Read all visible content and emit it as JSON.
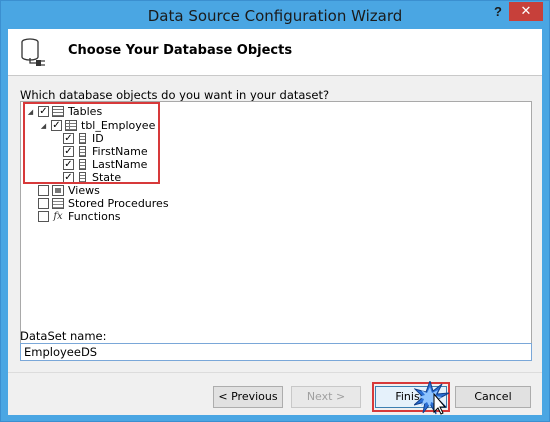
{
  "window": {
    "title": "Data Source Configuration Wizard",
    "help_glyph": "?",
    "close_glyph": "✕"
  },
  "header": {
    "title": "Choose Your Database Objects",
    "icon": "database-plug-icon"
  },
  "prompt": "Which database objects do you want in your dataset?",
  "tree": {
    "tables": {
      "label": "Tables",
      "checked": true,
      "expanded": true
    },
    "table": {
      "label": "tbl_Employee",
      "checked": true,
      "expanded": true
    },
    "columns": [
      {
        "label": "ID",
        "checked": true
      },
      {
        "label": "FirstName",
        "checked": true
      },
      {
        "label": "LastName",
        "checked": true
      },
      {
        "label": "State",
        "checked": true
      }
    ],
    "views": {
      "label": "Views",
      "checked": false
    },
    "stored_procedures": {
      "label": "Stored Procedures",
      "checked": false
    },
    "functions": {
      "label": "Functions",
      "checked": false,
      "icon_glyph": "fx"
    }
  },
  "dataset": {
    "label": "DataSet name:",
    "value": "EmployeeDS"
  },
  "buttons": {
    "previous": "< Previous",
    "next": "Next >",
    "finish": "Finish",
    "cancel": "Cancel"
  },
  "colors": {
    "highlight": "#d7393a",
    "titlebar": "#4aa6e3",
    "close": "#c7403a"
  }
}
